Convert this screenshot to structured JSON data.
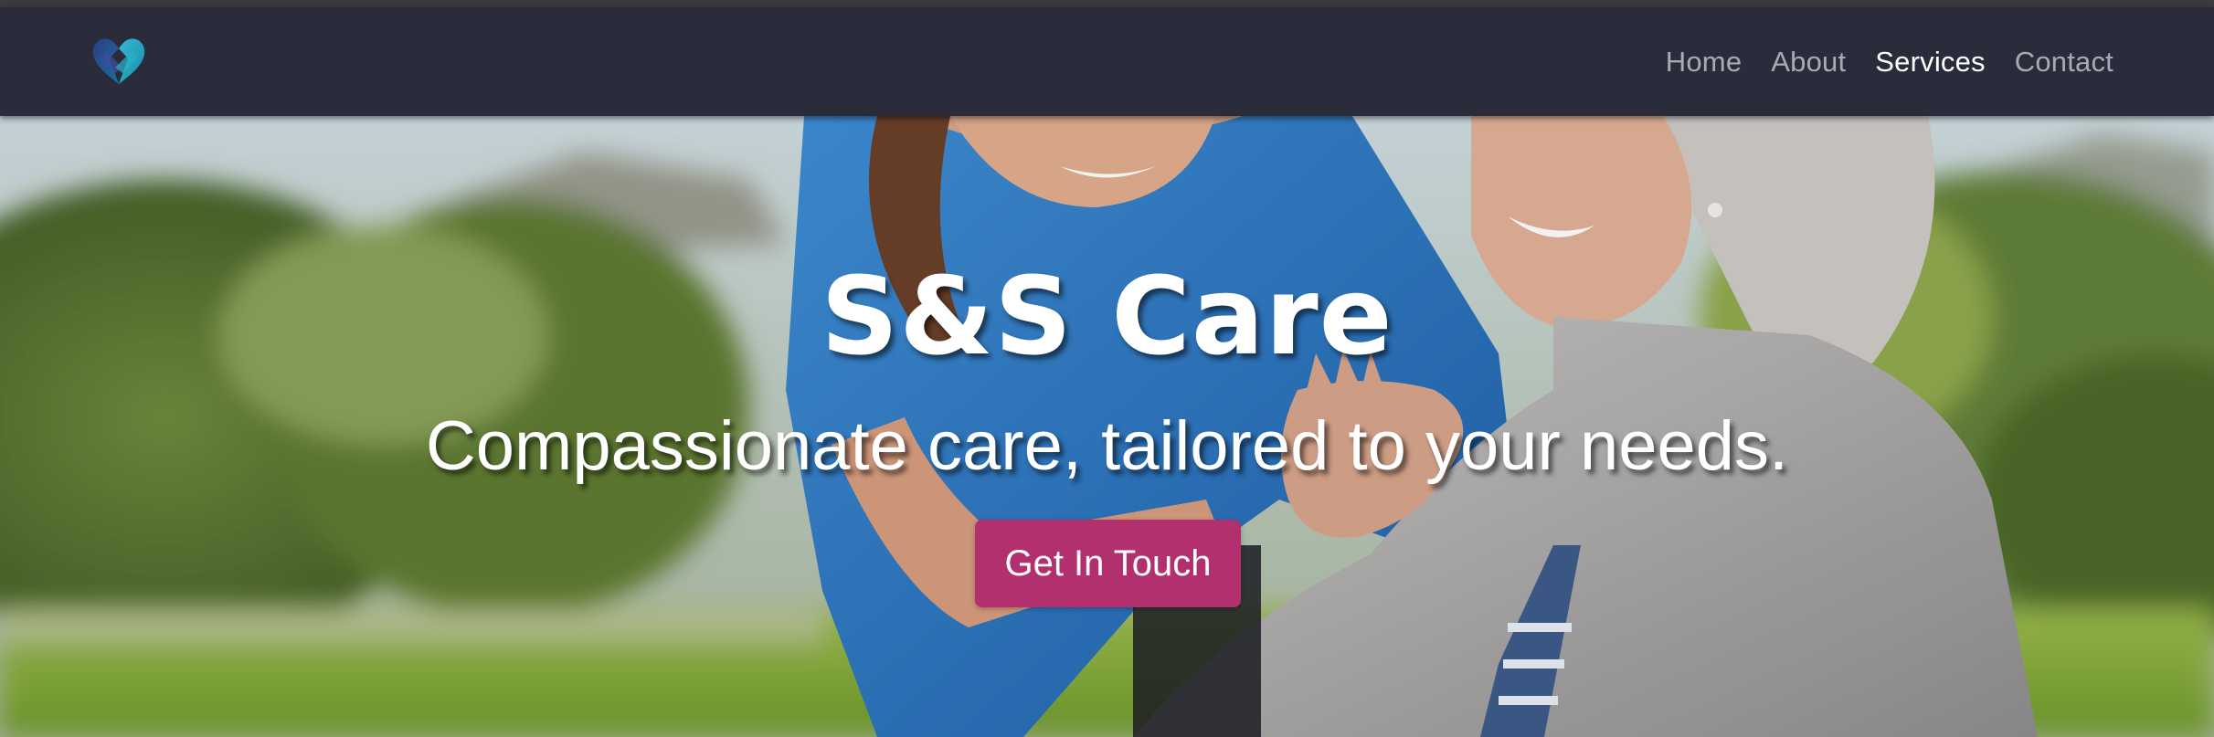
{
  "brand": {
    "logo_icon": "heart-hands-icon",
    "colors": {
      "logo_dark": "#1f3e7a",
      "logo_teal": "#2aa7c2"
    }
  },
  "nav": {
    "items": [
      {
        "label": "Home",
        "active": false
      },
      {
        "label": "About",
        "active": false
      },
      {
        "label": "Services",
        "active": true
      },
      {
        "label": "Contact",
        "active": false
      }
    ]
  },
  "hero": {
    "title": "S&S Care",
    "subtitle": "Compassionate care, tailored to your needs.",
    "cta_label": "Get In Touch",
    "image_description_icon": "caregiver-and-senior-photo"
  },
  "colors": {
    "navbar": "#2a2c3b",
    "nav_text": "#a9abb4",
    "nav_active": "#ffffff",
    "cta": "#b3306f"
  }
}
